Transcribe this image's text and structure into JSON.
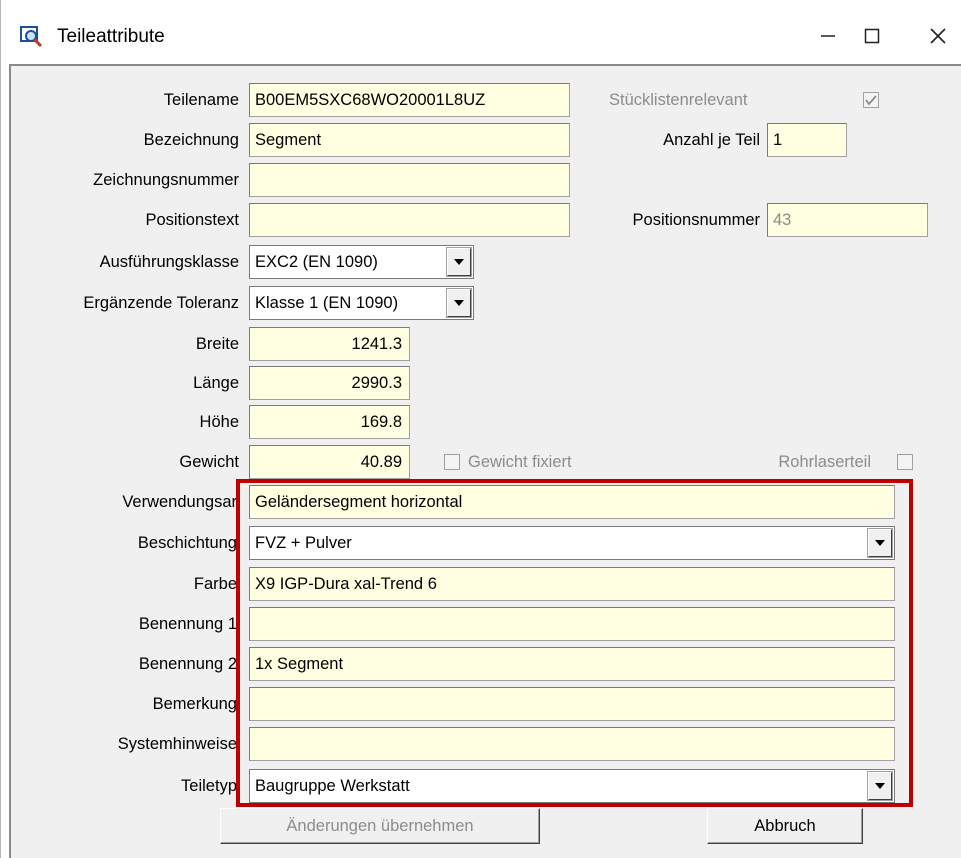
{
  "window": {
    "title": "Teileattribute"
  },
  "fields": {
    "teilename": {
      "label": "Teilename",
      "value": "B00EM5SXC68WO20001L8UZ"
    },
    "stuecklistenrelevant": {
      "label": "Stücklistenrelevant",
      "checked": true
    },
    "bezeichnung": {
      "label": "Bezeichnung",
      "value": "Segment"
    },
    "anzahl": {
      "label": "Anzahl je Teil",
      "value": "1"
    },
    "zeichnungsnummer": {
      "label": "Zeichnungsnummer",
      "value": ""
    },
    "positionstext": {
      "label": "Positionstext",
      "value": ""
    },
    "positionsnummer": {
      "label": "Positionsnummer",
      "value": "43"
    },
    "ausfuehrungsklasse": {
      "label": "Ausführungsklasse",
      "value": "EXC2 (EN 1090)"
    },
    "toleranz": {
      "label": "Ergänzende Toleranz",
      "value": "Klasse 1 (EN 1090)"
    },
    "breite": {
      "label": "Breite",
      "value": "1241.3"
    },
    "laenge": {
      "label": "Länge",
      "value": "2990.3"
    },
    "hoehe": {
      "label": "Höhe",
      "value": "169.8"
    },
    "gewicht": {
      "label": "Gewicht",
      "value": "40.89"
    },
    "gewicht_fixiert": {
      "label": "Gewicht fixiert",
      "checked": false
    },
    "rohrlaserteil": {
      "label": "Rohrlaserteil",
      "checked": false
    },
    "verwendungsart": {
      "label": "Verwendungsar",
      "value": "Geländersegment horizontal"
    },
    "beschichtung": {
      "label": "Beschichtung",
      "value": "FVZ + Pulver"
    },
    "farbe": {
      "label": "Farbe",
      "value": "X9 IGP-Dura xal-Trend 6"
    },
    "benennung1": {
      "label": "Benennung 1",
      "value": ""
    },
    "benennung2": {
      "label": "Benennung 2",
      "value": "1x Segment"
    },
    "bemerkung": {
      "label": "Bemerkung",
      "value": ""
    },
    "systemhinweise": {
      "label": "Systemhinweise",
      "value": ""
    },
    "teiletyp": {
      "label": "Teiletyp",
      "value": "Baugruppe Werkstatt"
    }
  },
  "buttons": {
    "apply": "Änderungen übernehmen",
    "cancel": "Abbruch"
  },
  "colors": {
    "field_bg": "#ffffe1",
    "highlight": "#c00000",
    "dialog_bg": "#f0f0f0"
  }
}
